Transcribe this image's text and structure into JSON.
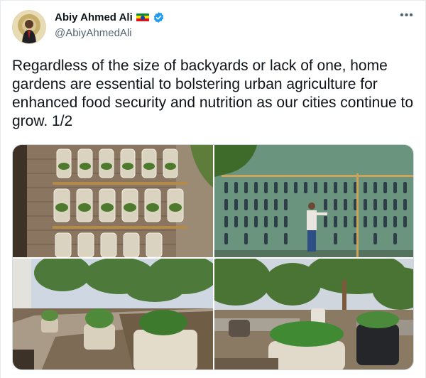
{
  "author": {
    "display_name": "Abiy Ahmed Ali",
    "handle": "@AbiyAhmedAli",
    "flag_icon": "ethiopia-flag-icon",
    "verified_icon": "verified-badge-icon"
  },
  "menu": {
    "more_label": "•••"
  },
  "tweet": {
    "text": "Regardless of the size of backyards or lack of one, home gardens are essential to bolstering urban agriculture for enhanced food security and nutrition as our cities continue to grow. 1/2"
  },
  "media": {
    "photos": [
      {
        "subject": "hanging plastic bottle planters on brick wall"
      },
      {
        "subject": "man tending vertical bottle garden on green wall"
      },
      {
        "subject": "raised garden beds with sack planters"
      },
      {
        "subject": "sack planters in urban garden under trees"
      }
    ]
  },
  "colors": {
    "text": "#0f1419",
    "secondary": "#536471",
    "verified": "#1d9bf0",
    "border": "#cfd9de"
  }
}
